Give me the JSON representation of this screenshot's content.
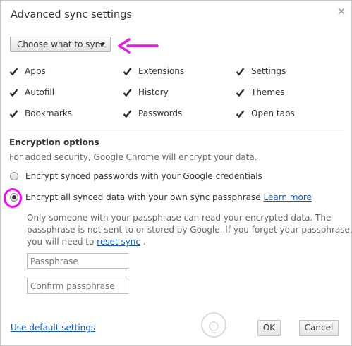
{
  "dialog": {
    "title": "Advanced sync settings",
    "close_glyph": "×"
  },
  "sync": {
    "dropdown_label": "Choose what to sync",
    "items": [
      {
        "label": "Apps",
        "checked": true
      },
      {
        "label": "Extensions",
        "checked": true
      },
      {
        "label": "Settings",
        "checked": true
      },
      {
        "label": "Autofill",
        "checked": true
      },
      {
        "label": "History",
        "checked": true
      },
      {
        "label": "Themes",
        "checked": true
      },
      {
        "label": "Bookmarks",
        "checked": true
      },
      {
        "label": "Passwords",
        "checked": true
      },
      {
        "label": "Open tabs",
        "checked": true
      }
    ]
  },
  "encryption": {
    "heading": "Encryption options",
    "description": "For added security, Google Chrome will encrypt your data.",
    "option_google": "Encrypt synced passwords with your Google credentials",
    "option_passphrase": "Encrypt all synced data with your own sync passphrase",
    "learn_more": "Learn more",
    "selected": "passphrase",
    "info_line1": "Only someone with your passphrase can read your encrypted data. The",
    "info_line2": "passphrase is not sent to or stored by Google. If you forget your passphrase,",
    "info_line3_prefix": "you will need to",
    "reset_sync": "reset sync",
    "info_line3_suffix": ".",
    "passphrase_placeholder": "Passphrase",
    "confirm_placeholder": "Confirm passphrase"
  },
  "footer": {
    "default_settings": "Use default settings",
    "ok": "OK",
    "cancel": "Cancel"
  },
  "colors": {
    "link": "#1155cc",
    "annotation": "#ff00ff"
  }
}
